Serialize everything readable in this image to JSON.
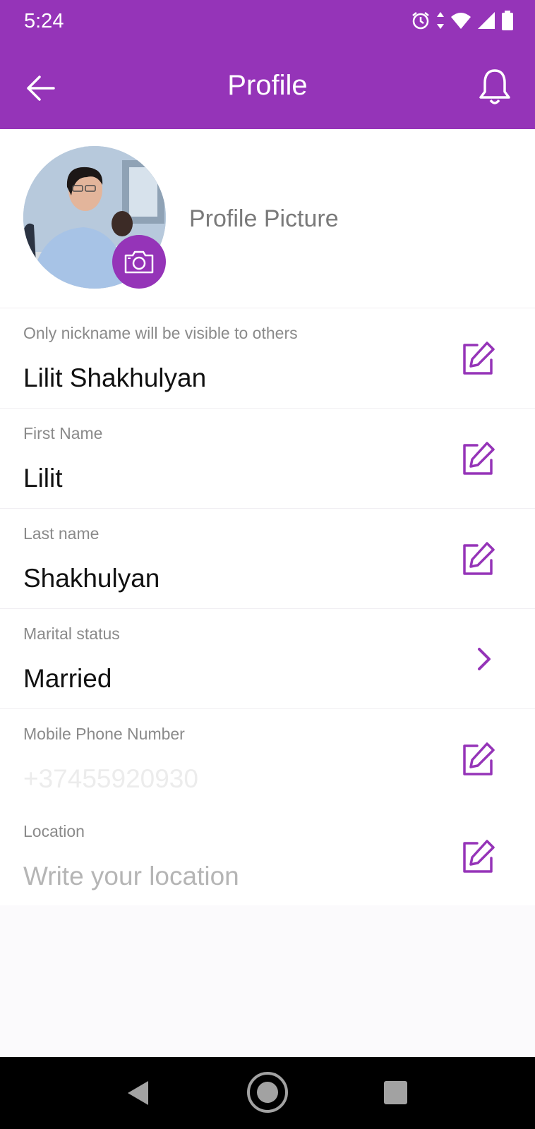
{
  "status_bar": {
    "time": "5:24",
    "icons": [
      "alarm-icon",
      "data-arrows-icon",
      "wifi-icon",
      "signal-icon",
      "battery-icon"
    ]
  },
  "app_bar": {
    "title": "Profile",
    "icons": [
      "back-arrow-icon",
      "bell-icon"
    ]
  },
  "profile_picture": {
    "label": "Profile Picture",
    "icon": "camera-icon"
  },
  "fields": [
    {
      "label": "Only nickname will be visible to others",
      "value": "Lilit Shakhulyan",
      "action": "edit"
    },
    {
      "label": "First Name",
      "value": "Lilit",
      "action": "edit"
    },
    {
      "label": "Last name",
      "value": "Shakhulyan",
      "action": "edit"
    },
    {
      "label": "Marital status",
      "value": "Married",
      "action": "chevron"
    },
    {
      "label": "Mobile Phone Number",
      "value": "+37455920930",
      "action": "edit"
    },
    {
      "label": "Location",
      "placeholder": "Write your location",
      "action": "edit"
    }
  ],
  "colors": {
    "primary": "#9534b8",
    "background": "#fbfafc",
    "nav_bar": "#000000"
  },
  "nav_bar": {
    "icons": [
      "nav-back-icon",
      "nav-home-icon",
      "nav-recents-icon"
    ]
  }
}
